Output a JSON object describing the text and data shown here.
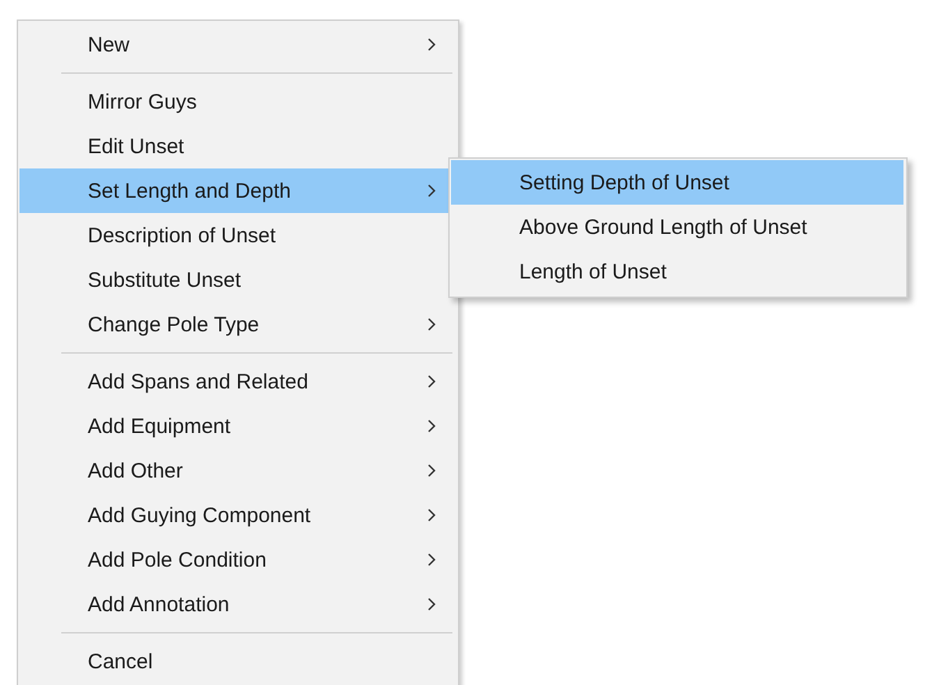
{
  "menu": {
    "items": [
      {
        "kind": "item",
        "label": "New",
        "submenu": true,
        "selected": false
      },
      {
        "kind": "separator"
      },
      {
        "kind": "item",
        "label": "Mirror Guys",
        "submenu": false,
        "selected": false
      },
      {
        "kind": "item",
        "label": "Edit Unset",
        "submenu": false,
        "selected": false
      },
      {
        "kind": "item",
        "label": "Set Length and Depth",
        "submenu": true,
        "selected": true
      },
      {
        "kind": "item",
        "label": "Description of Unset",
        "submenu": false,
        "selected": false
      },
      {
        "kind": "item",
        "label": "Substitute Unset",
        "submenu": false,
        "selected": false
      },
      {
        "kind": "item",
        "label": "Change Pole Type",
        "submenu": true,
        "selected": false
      },
      {
        "kind": "separator"
      },
      {
        "kind": "item",
        "label": "Add Spans and Related",
        "submenu": true,
        "selected": false
      },
      {
        "kind": "item",
        "label": "Add Equipment",
        "submenu": true,
        "selected": false
      },
      {
        "kind": "item",
        "label": "Add Other",
        "submenu": true,
        "selected": false
      },
      {
        "kind": "item",
        "label": "Add Guying Component",
        "submenu": true,
        "selected": false
      },
      {
        "kind": "item",
        "label": "Add Pole Condition",
        "submenu": true,
        "selected": false
      },
      {
        "kind": "item",
        "label": "Add Annotation",
        "submenu": true,
        "selected": false
      },
      {
        "kind": "separator"
      },
      {
        "kind": "item",
        "label": "Cancel",
        "submenu": false,
        "selected": false
      }
    ]
  },
  "submenu": {
    "items": [
      {
        "label": "Setting Depth of Unset",
        "selected": true
      },
      {
        "label": "Above Ground Length of Unset",
        "selected": false
      },
      {
        "label": "Length of Unset",
        "selected": false
      }
    ]
  }
}
